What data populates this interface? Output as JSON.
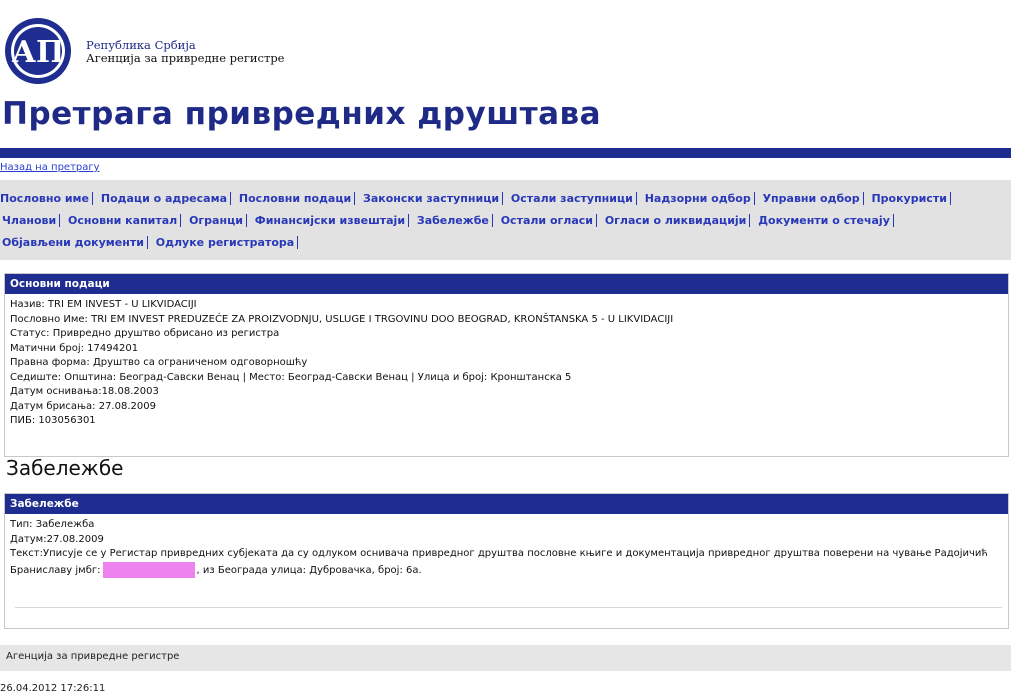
{
  "header": {
    "logo_text": "АПР",
    "org_line1": "Република Србија",
    "org_line2": "Агенција за привредне регистре"
  },
  "page_title": "Претрага привредних друштава",
  "back_link": "Назад на претрагу",
  "nav": {
    "items": [
      "Пословно име",
      "Подаци о адресама",
      "Пословни подаци",
      "Законски заступници",
      "Остали заступници",
      "Надзорни одбор",
      "Управни одбор",
      "Прокуристи",
      "Чланови",
      "Основни капитал",
      "Огранци",
      "Финансијски извештаји",
      "Забележбе",
      "Остали огласи",
      "Огласи о ликвидацији",
      "Документи о стечају",
      "Објављени документи",
      "Одлуке регистратора"
    ]
  },
  "basic": {
    "heading": "Основни подаци",
    "lines": [
      "Назив: TRI EM INVEST - U LIKVIDACIJI",
      "Пословно Име: TRI EM INVEST PREDUZEĆE ZA PROIZVODNJU, USLUGE I TRGOVINU DOO BEOGRAD, KRONŠTANSKA 5 - U LIKVIDACIJI",
      "Статус: Привредно друштво обрисано из регистра",
      "Матични број: 17494201",
      "Правна форма: Друштво са ограниченом одговорношћу",
      "Седиште: Општина: Београд-Савски Венац | Место: Београд-Савски Венац | Улица и број: Кронштанска 5",
      "Датум оснивања:18.08.2003",
      "Датум брисања: 27.08.2009",
      "ПИБ: 103056301"
    ]
  },
  "notes_section": {
    "title": "Забележбе",
    "heading": "Забележбе",
    "type_line": "Тип: Забележба",
    "date_line": "Датум:27.08.2009",
    "text_part1": "Текст:Уписује се у Регистар привредних субјеката да су одлуком оснивача привредног друштва пословне књиге и документација привредног друштва поверени на чување Радојичић Браниславу јмбг:",
    "text_part2": ", из Београда улица: Дубровачка, број: 6а."
  },
  "footer": {
    "agency": "Агенција за привредне регистре",
    "timestamp": "26.04.2012 17:26:11"
  }
}
